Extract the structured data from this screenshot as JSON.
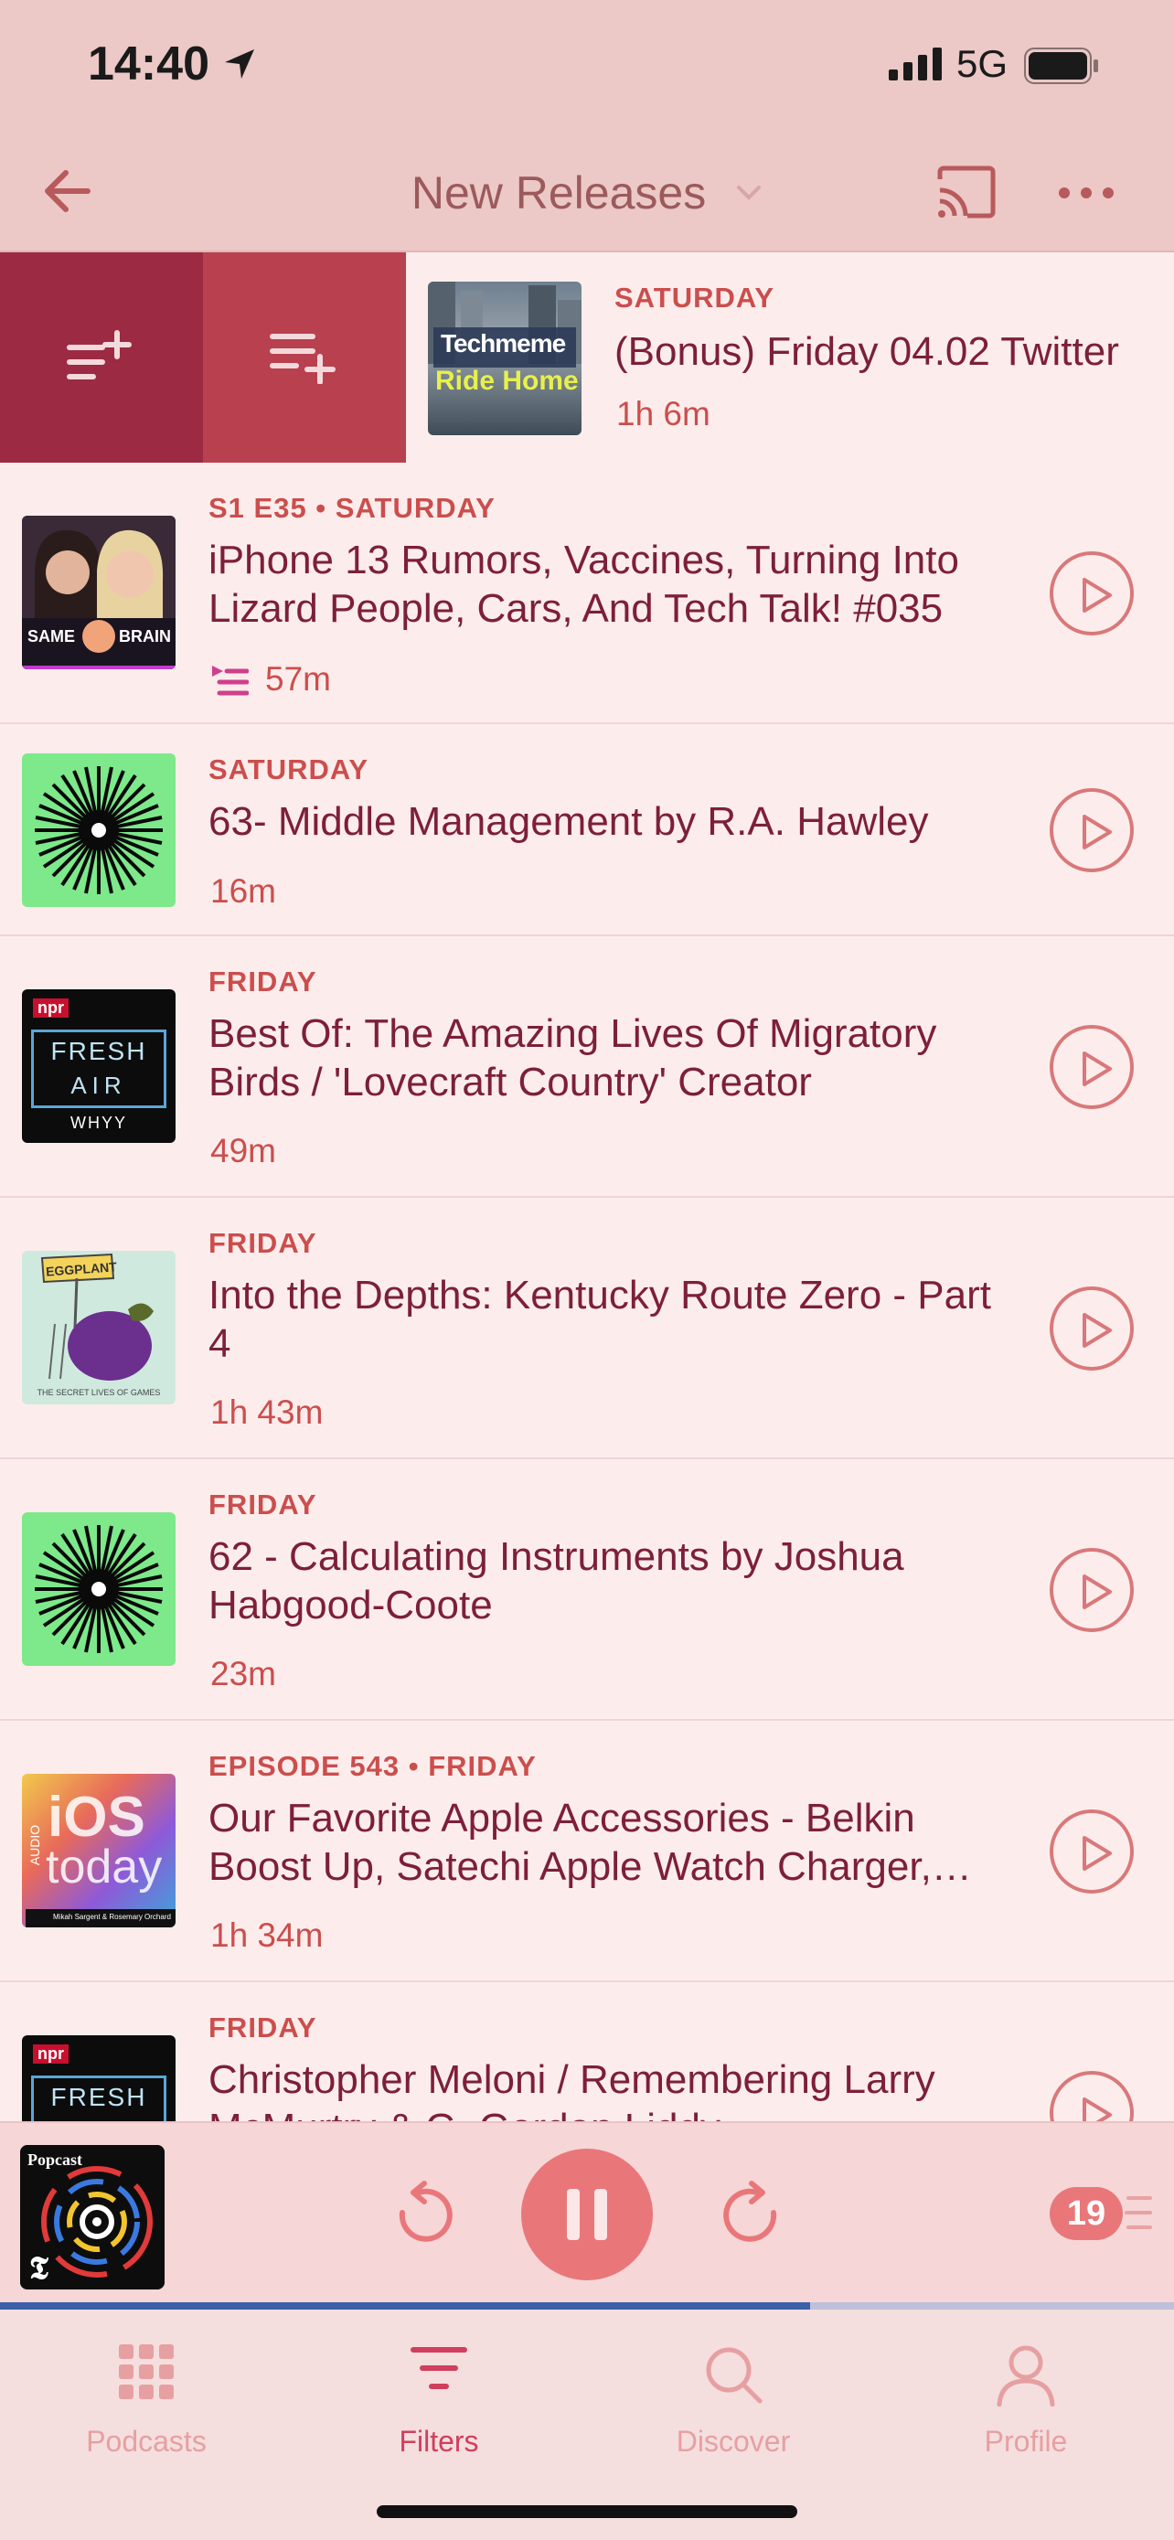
{
  "status_bar": {
    "time": "14:40",
    "network": "5G"
  },
  "nav": {
    "title": "New Releases"
  },
  "swipe_row": {
    "meta": "SATURDAY",
    "title": "(Bonus) Friday 04.02 Twitter",
    "duration": "1h 6m",
    "art_line1": "Techmeme",
    "art_line2": "Ride Home"
  },
  "episodes": [
    {
      "meta": "S1 E35 • SATURDAY",
      "title": "iPhone 13 Rumors, Vaccines, Turning Into Lizard People, Cars, And Tech Talk! #035",
      "duration": "57m",
      "queued": true,
      "art_left": "SAME",
      "art_right": "BRAIN"
    },
    {
      "meta": "SATURDAY",
      "title": "63- Middle Management by R.A. Hawley",
      "duration": "16m"
    },
    {
      "meta": "FRIDAY",
      "title": "Best Of: The Amazing Lives Of Migratory Birds / 'Lovecraft Country' Creator",
      "duration": "49m",
      "art_top": "npr",
      "art_l1": "FRESH",
      "art_l2": "AIR",
      "art_l3": "WHYY"
    },
    {
      "meta": "FRIDAY",
      "title": "Into the Depths: Kentucky Route Zero - Part 4",
      "duration": "1h 43m",
      "art_sign": "EGGPLANT",
      "art_caption": "THE SECRET LIVES OF GAMES"
    },
    {
      "meta": "FRIDAY",
      "title": "62 - Calculating Instruments by Joshua Habgood-Coote",
      "duration": "23m"
    },
    {
      "meta": "EPISODE 543 • FRIDAY",
      "title": "Our Favorite Apple Accessories - Belkin Boost Up, Satechi Apple Watch Charger,…",
      "duration": "1h 34m",
      "art_big1": "iOS",
      "art_big2": "today",
      "art_side": "AUDIO",
      "art_credit": "Mikah Sargent & Rosemary Orchard"
    },
    {
      "meta": "FRIDAY",
      "title": "Christopher Meloni / Remembering Larry McMurtry & G. Gordon Liddy",
      "duration": "",
      "art_top": "npr",
      "art_l1": "FRESH"
    }
  ],
  "player": {
    "art_label": "Popcast",
    "up_next_count": "19",
    "progress": 0.69
  },
  "tabs": [
    {
      "label": "Podcasts",
      "active": false
    },
    {
      "label": "Filters",
      "active": true
    },
    {
      "label": "Discover",
      "active": false
    },
    {
      "label": "Profile",
      "active": false
    }
  ],
  "colors": {
    "accent": "#d03f5c",
    "title": "#7d1f3a",
    "meta": "#cb4e4d",
    "background": "#fcedec"
  }
}
